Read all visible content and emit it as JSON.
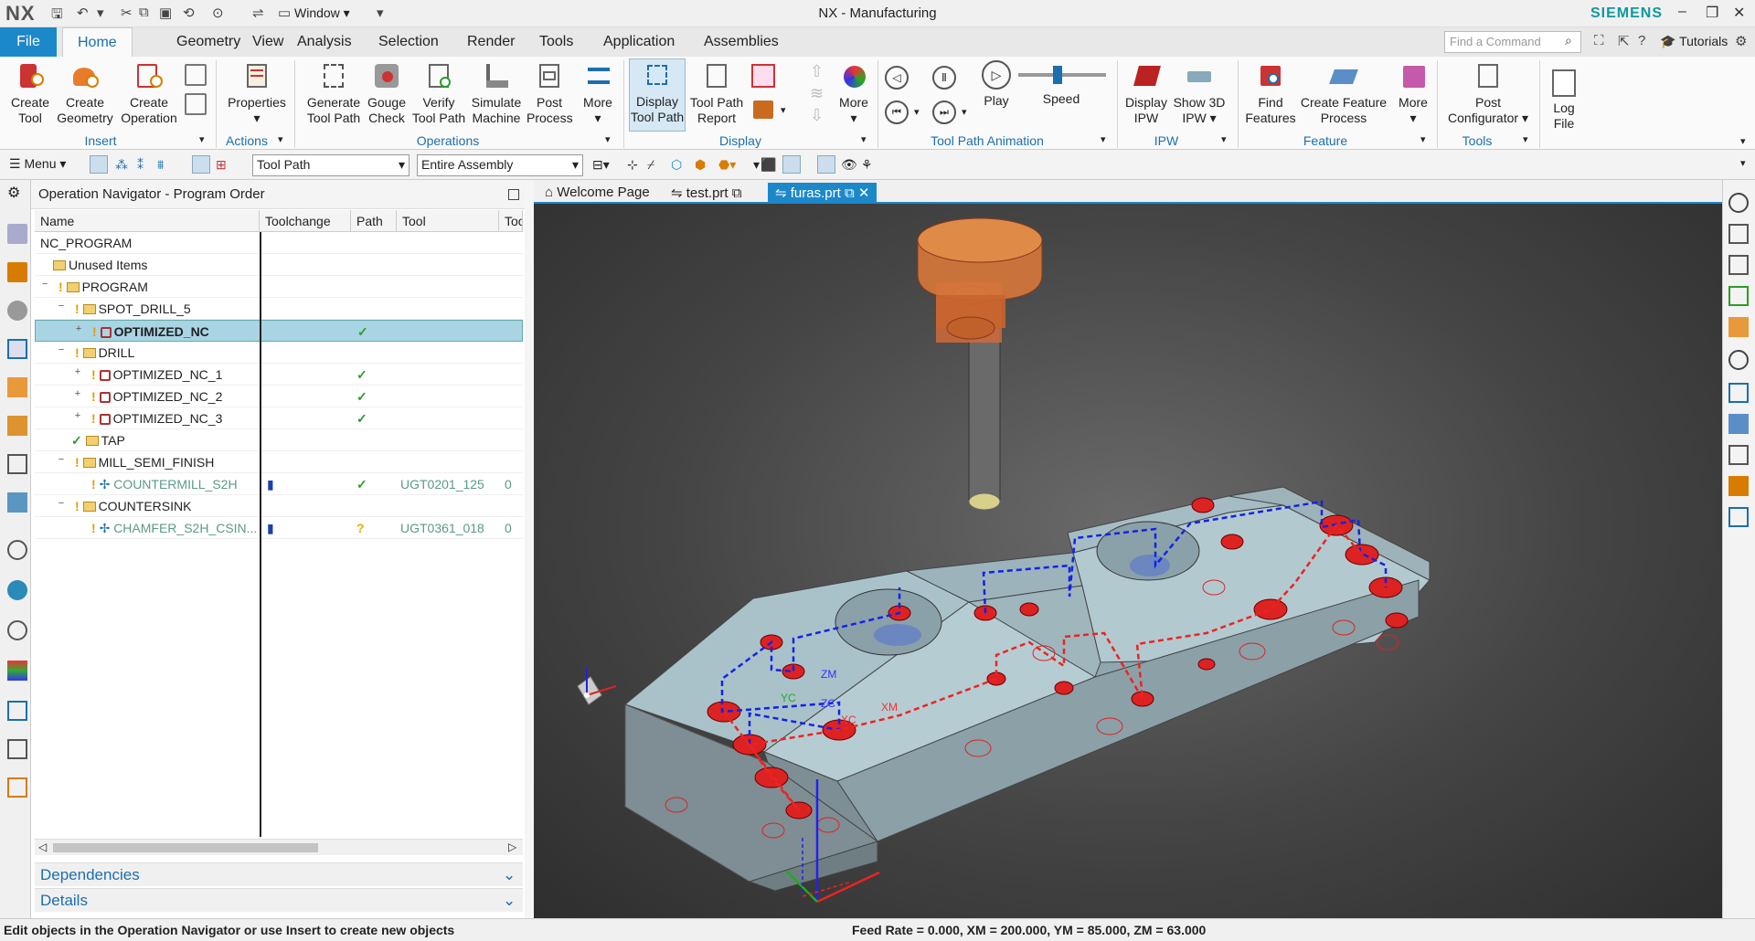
{
  "app": {
    "logo": "NX",
    "title": "NX - Manufacturing",
    "brand": "SIEMENS",
    "window_menu": "Window",
    "tutorials": "Tutorials"
  },
  "menu": {
    "file": "File",
    "tabs": [
      "Home",
      "Geometry",
      "View",
      "Analysis",
      "Selection",
      "Render",
      "Tools",
      "Application",
      "Assemblies"
    ],
    "active": "Home",
    "find_placeholder": "Find a Command"
  },
  "ribbon": {
    "buttons": [
      {
        "l1": "Create",
        "l2": "Tool"
      },
      {
        "l1": "Create",
        "l2": "Geometry"
      },
      {
        "l1": "Create",
        "l2": "Operation"
      },
      {
        "l1": "Properties",
        "l2": ""
      },
      {
        "l1": "Generate",
        "l2": "Tool Path"
      },
      {
        "l1": "Gouge",
        "l2": "Check"
      },
      {
        "l1": "Verify",
        "l2": "Tool Path"
      },
      {
        "l1": "Simulate",
        "l2": "Machine"
      },
      {
        "l1": "Post",
        "l2": "Process"
      },
      {
        "l1": "More",
        "l2": ""
      },
      {
        "l1": "Display",
        "l2": "Tool Path"
      },
      {
        "l1": "Tool Path",
        "l2": "Report"
      },
      {
        "l1": "More",
        "l2": ""
      },
      {
        "l1": "Play",
        "l2": ""
      },
      {
        "l1": "Speed",
        "l2": ""
      },
      {
        "l1": "Display",
        "l2": "IPW"
      },
      {
        "l1": "Show 3D",
        "l2": "IPW"
      },
      {
        "l1": "Find",
        "l2": "Features"
      },
      {
        "l1": "Create Feature",
        "l2": "Process"
      },
      {
        "l1": "More",
        "l2": ""
      },
      {
        "l1": "Post",
        "l2": "Configurator"
      },
      {
        "l1": "Log",
        "l2": "File"
      }
    ],
    "groups": [
      "Insert",
      "Actions",
      "Operations",
      "Display",
      "Tool Path Animation",
      "IPW",
      "Feature",
      "Tools"
    ]
  },
  "toolbar2": {
    "menu": "Menu",
    "filter": "Tool Path",
    "scope": "Entire Assembly"
  },
  "navigator": {
    "title": "Operation Navigator - Program Order",
    "columns": [
      "Name",
      "Toolchange",
      "Path",
      "Tool",
      "Too"
    ],
    "rows": [
      {
        "name": "NC_PROGRAM",
        "path": "",
        "tool": "",
        "toolno": ""
      },
      {
        "name": "Unused Items",
        "path": "",
        "tool": "",
        "toolno": ""
      },
      {
        "name": "PROGRAM",
        "path": "",
        "tool": "",
        "toolno": ""
      },
      {
        "name": "SPOT_DRILL_5",
        "path": "",
        "tool": "",
        "toolno": ""
      },
      {
        "name": "OPTIMIZED_NC",
        "path": "✓",
        "tool": "",
        "toolno": ""
      },
      {
        "name": "DRILL",
        "path": "",
        "tool": "",
        "toolno": ""
      },
      {
        "name": "OPTIMIZED_NC_1",
        "path": "✓",
        "tool": "",
        "toolno": ""
      },
      {
        "name": "OPTIMIZED_NC_2",
        "path": "✓",
        "tool": "",
        "toolno": ""
      },
      {
        "name": "OPTIMIZED_NC_3",
        "path": "✓",
        "tool": "",
        "toolno": ""
      },
      {
        "name": "TAP",
        "path": "",
        "tool": "",
        "toolno": ""
      },
      {
        "name": "MILL_SEMI_FINISH",
        "path": "",
        "tool": "",
        "toolno": ""
      },
      {
        "name": "COUNTERMILL_S2H",
        "path": "✓",
        "tool": "UGT0201_125",
        "toolno": "0"
      },
      {
        "name": "COUNTERSINK",
        "path": "",
        "tool": "",
        "toolno": ""
      },
      {
        "name": "CHAMFER_S2H_CSIN...",
        "path": "?",
        "tool": "UGT0361_018",
        "toolno": "0"
      }
    ],
    "panels": [
      "Dependencies",
      "Details"
    ]
  },
  "doctabs": [
    "Welcome Page",
    "test.prt",
    "furas.prt"
  ],
  "active_doc": "furas.prt",
  "axes": {
    "zm": "ZM",
    "zc": "ZC",
    "xc": "XC",
    "xm": "XM",
    "yc": "YC"
  },
  "status": {
    "left": "Edit objects in the Operation Navigator or use Insert to create new objects",
    "right": "Feed Rate = 0.000, XM = 200.000, YM = 85.000, ZM = 63.000"
  }
}
